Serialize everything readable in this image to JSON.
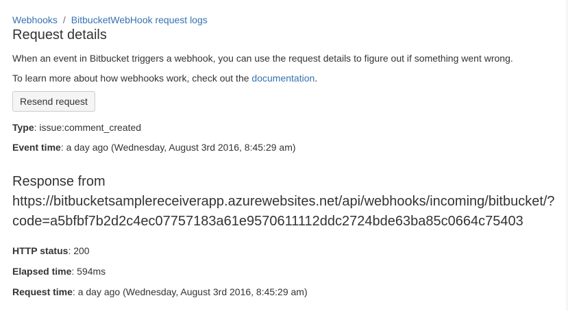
{
  "breadcrumb": {
    "webhooks": "Webhooks",
    "separator": "/",
    "current": "BitbucketWebHook request logs"
  },
  "page": {
    "title": "Request details",
    "intro": "When an event in Bitbucket triggers a webhook, you can use the request details to figure out if something went wrong.",
    "learn_prefix": "To learn more about how webhooks work, check out the ",
    "learn_link": "documentation",
    "learn_suffix": ".",
    "resend_label": "Resend request"
  },
  "request": {
    "type_label": "Type",
    "type_value": ": issue:comment_created",
    "event_time_label": "Event time",
    "event_time_value": ": a day ago (Wednesday, August 3rd 2016, 8:45:29 am)"
  },
  "response": {
    "heading_prefix": "Response from",
    "url": "https://bitbucketsamplereceiverapp.azurewebsites.net/api/webhooks/incoming/bitbucket/?code=a5bfbf7b2d2c4ec07757183a61e9570611112ddc2724bde63ba85c0664c75403",
    "http_status_label": "HTTP status",
    "http_status_value": ": 200",
    "elapsed_label": "Elapsed time",
    "elapsed_value": ": 594ms",
    "request_time_label": "Request time",
    "request_time_value": ": a day ago (Wednesday, August 3rd 2016, 8:45:29 am)"
  },
  "colors": {
    "link": "#3572b0",
    "text": "#333333",
    "button_bg": "#f5f5f5",
    "button_border": "#cccccc"
  }
}
